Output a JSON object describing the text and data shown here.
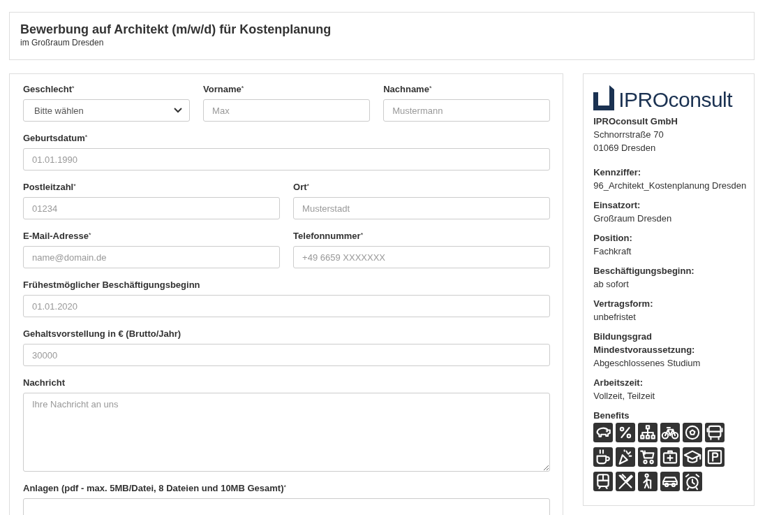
{
  "header": {
    "title": "Bewerbung auf Architekt (m/w/d) für Kostenplanung",
    "subtitle": "im Großraum Dresden"
  },
  "form": {
    "rows": [
      {
        "fields": [
          {
            "kind": "select",
            "label": "Geschlecht",
            "marker": "*",
            "value": "Bitte wählen"
          },
          {
            "kind": "input",
            "label": "Vorname",
            "marker": "*",
            "placeholder": "Max"
          },
          {
            "kind": "input",
            "label": "Nachname",
            "marker": "*",
            "placeholder": "Mustermann"
          }
        ]
      },
      {
        "fields": [
          {
            "kind": "input",
            "label": "Geburtsdatum",
            "marker": "*",
            "placeholder": "01.01.1990"
          }
        ]
      },
      {
        "fields": [
          {
            "kind": "input",
            "label": "Postleitzahl",
            "marker": "*",
            "placeholder": "01234"
          },
          {
            "kind": "input",
            "label": "Ort",
            "marker": "*",
            "placeholder": "Musterstadt"
          }
        ]
      },
      {
        "fields": [
          {
            "kind": "input",
            "label": "E-Mail-Adresse",
            "marker": "*",
            "placeholder": "name@domain.de"
          },
          {
            "kind": "input",
            "label": "Telefonnummer",
            "marker": "*",
            "placeholder": "+49 6659 XXXXXXX"
          }
        ]
      },
      {
        "fields": [
          {
            "kind": "input",
            "label": "Frühestmöglicher Beschäftigungsbeginn",
            "placeholder": "01.01.2020"
          }
        ]
      },
      {
        "fields": [
          {
            "kind": "input",
            "label": "Gehaltsvorstellung in € (Brutto/Jahr)",
            "placeholder": "30000"
          }
        ]
      },
      {
        "fields": [
          {
            "kind": "textarea",
            "label": "Nachricht",
            "placeholder": "Ihre Nachricht an uns"
          }
        ]
      },
      {
        "fields": [
          {
            "kind": "file",
            "label": "Anlagen (pdf - max. 5MB/Datei, 8 Dateien und 10MB Gesamt)",
            "marker": "*"
          }
        ]
      }
    ]
  },
  "company": {
    "logo_text": "IPROconsult",
    "name": "IPROconsult GmbH",
    "street": "Schnorrstraße 70",
    "city": "01069 Dresden",
    "details": [
      {
        "label": "Kennziffer:",
        "value": "96_Architekt_Kostenplanung Dresden"
      },
      {
        "label": "Einsatzort:",
        "value": "Großraum Dresden"
      },
      {
        "label": "Position:",
        "value": "Fachkraft"
      },
      {
        "label": "Beschäftigungsbeginn:",
        "value": "ab sofort"
      },
      {
        "label": "Vertragsform:",
        "value": "unbefristet"
      },
      {
        "label": "Bildungsgrad Mindestvoraussetzung:",
        "value": "Abgeschlossenes Studium"
      },
      {
        "label": "Arbeitszeit:",
        "value": "Vollzeit, Teilzeit"
      }
    ],
    "benefits_label": "Benefits"
  }
}
